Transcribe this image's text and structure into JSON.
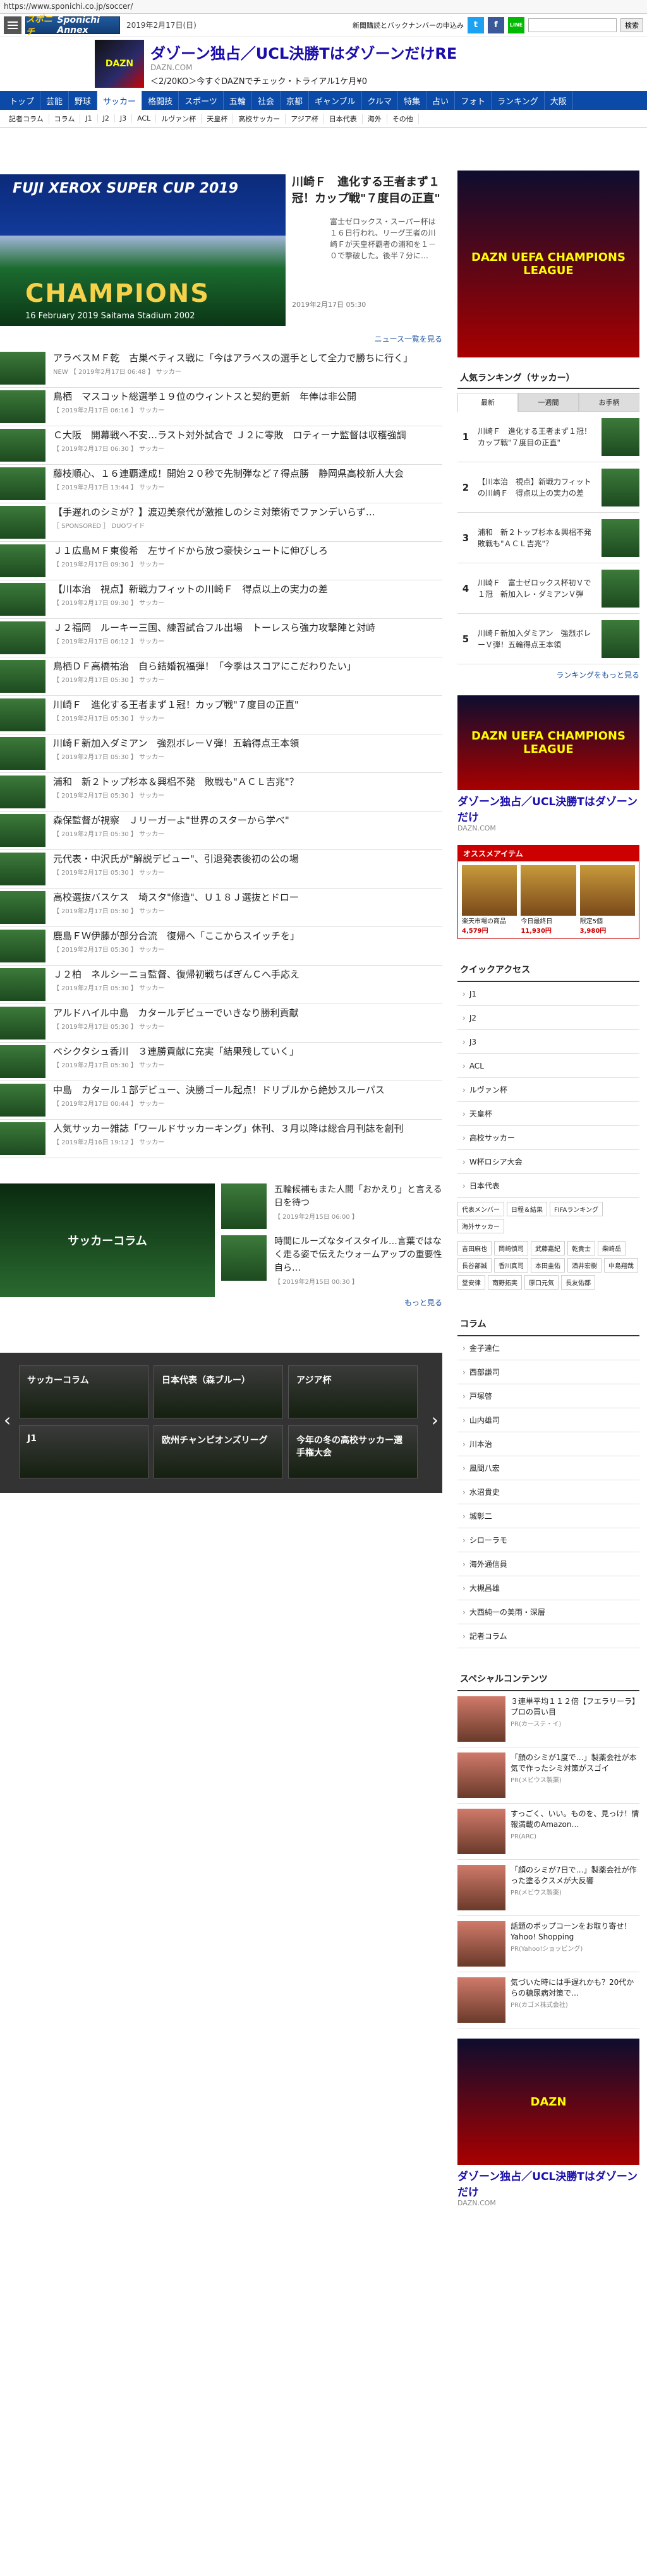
{
  "browser": {
    "url": "https://www.sponichi.co.jp/soccer/"
  },
  "header": {
    "logo": "Sponichi Annex",
    "logo_prefix": "スポニチ",
    "date": "2019年2月17日(日)",
    "sub_link": "新聞購読とバックナンバーの申込み",
    "search_placeholder": "",
    "search_btn": "検索",
    "sns": [
      {
        "name": "twitter",
        "glyph": "t",
        "color": "#1da1f2"
      },
      {
        "name": "facebook",
        "glyph": "f",
        "color": "#3b5998"
      },
      {
        "name": "line",
        "glyph": "LINE",
        "color": "#00b900"
      }
    ]
  },
  "top_ad": {
    "title": "ダゾーン独占／UCL決勝TはダゾーンだけRE",
    "domain": "DAZN.COM",
    "desc": "＜2/20KO＞今すぐDAZNでチェック・トライアル1ケ月¥0",
    "thumb": "DAZN"
  },
  "gnav": [
    "トップ",
    "芸能",
    "野球",
    "サッカー",
    "格闘技",
    "スポーツ",
    "五輪",
    "社会",
    "京都",
    "ギャンブル",
    "クルマ",
    "特集",
    "占い",
    "フォト",
    "ランキング",
    "大阪"
  ],
  "gnav_active": 3,
  "snav": [
    "記者コラム",
    "コラム",
    "J1",
    "J2",
    "J3",
    "ACL",
    "ルヴァン杯",
    "天皇杯",
    "高校サッカー",
    "アジア杯",
    "日本代表",
    "海外",
    "その他"
  ],
  "hero": {
    "banner_top": "FUJI XEROX SUPER CUP 2019",
    "banner_main": "CHAMPIONS",
    "banner_sub": "16 February 2019  Saitama Stadium 2002",
    "title": "川崎Ｆ　進化する王者まず１冠！カップ戦\"７度目の正直\"",
    "summary": "富士ゼロックス・スーパー杯は１６日行われ、リーグ王者の川崎Ｆが天皇杯覇者の浦和を１－０で撃破した。後半７分に…",
    "date": "2019年2月17日 05:30"
  },
  "news_more": "ニュース一覧を見る",
  "news": [
    {
      "title": "アラベスＭＦ乾　古巣ベティス戦に「今はアラベスの選手として全力で勝ちに行く」",
      "meta": "NEW 【 2019年2月17日 06:48 】 サッカー"
    },
    {
      "title": "鳥栖　マスコット総選挙１９位のウィントスと契約更新　年俸は非公開",
      "meta": "【 2019年2月17日 06:16 】 サッカー"
    },
    {
      "title": "Ｃ大阪　開幕戦へ不安…ラスト対外試合で Ｊ２に零敗　ロティーナ監督は収穫強調",
      "meta": "【 2019年2月17日 06:30 】 サッカー"
    },
    {
      "title": "藤枝順心、１６連覇達成！開始２０秒で先制弾など７得点勝　静岡県高校新人大会",
      "meta": "【 2019年2月17日 13:44 】 サッカー"
    },
    {
      "title": "【手遅れのシミが？】渡辺美奈代が激推しのシミ対策術でファンデいらず…",
      "meta": "［ SPONSORED ］ DUOワイド"
    },
    {
      "title": "Ｊ１広島ＭＦ東俊希　左サイドから放つ豪快シュートに伸びしろ",
      "meta": "【 2019年2月17日 09:30 】 サッカー"
    },
    {
      "title": "【川本治　視点】新戦力フィットの川崎Ｆ　得点以上の実力の差",
      "meta": "【 2019年2月17日 09:30 】 サッカー"
    },
    {
      "title": "Ｊ２福岡　ルーキー三国、練習試合フル出場　トーレスら強力攻撃陣と対峙",
      "meta": "【 2019年2月17日 06:12 】 サッカー"
    },
    {
      "title": "鳥栖ＤＦ高橋祐治　自ら結婚祝福弾！「今季はスコアにこだわりたい」",
      "meta": "【 2019年2月17日 05:30 】 サッカー"
    },
    {
      "title": "川崎Ｆ　進化する王者まず１冠！カップ戦\"７度目の正直\"",
      "meta": "【 2019年2月17日 05:30 】 サッカー"
    },
    {
      "title": "川崎Ｆ新加入ダミアン　強烈ボレーＶ弾！五輪得点王本領",
      "meta": "【 2019年2月17日 05:30 】 サッカー"
    },
    {
      "title": "浦和　新２トップ杉本＆興梠不発　敗戦も\"ＡＣＬ吉兆\"？",
      "meta": "【 2019年2月17日 05:30 】 サッカー"
    },
    {
      "title": "森保監督が視察　Ｊリーガーよ\"世界のスターから学べ\"",
      "meta": "【 2019年2月17日 05:30 】 サッカー"
    },
    {
      "title": "元代表・中沢氏が\"解説デビュー\"、引退発表後初の公の場",
      "meta": "【 2019年2月17日 05:30 】 サッカー"
    },
    {
      "title": "高校選抜バスケス　埼スタ\"修造\"、Ｕ１８Ｊ選抜とドロー",
      "meta": "【 2019年2月17日 05:30 】 サッカー"
    },
    {
      "title": "鹿島ＦＷ伊藤が部分合流　復帰へ「ここからスイッチを」",
      "meta": "【 2019年2月17日 05:30 】 サッカー"
    },
    {
      "title": "Ｊ２柏　ネルシーニョ監督、復帰初戦ちばぎんＣへ手応え",
      "meta": "【 2019年2月17日 05:30 】 サッカー"
    },
    {
      "title": "アルドハイル中島　カタールデビューでいきなり勝利貢献",
      "meta": "【 2019年2月17日 05:30 】 サッカー"
    },
    {
      "title": "ベシクタシュ香川　３連勝貢献に充実「結果残していく」",
      "meta": "【 2019年2月17日 05:30 】 サッカー"
    },
    {
      "title": "中島　カタール１部デビュー、決勝ゴール起点！ドリブルから絶妙スルーパス",
      "meta": "【 2019年2月17日 00:44 】 サッカー"
    },
    {
      "title": "人気サッカー雑誌「ワールドサッカーキング」休刊、３月以降は総合月刊誌を創刊",
      "meta": "【 2019年2月16日 19:12 】 サッカー"
    }
  ],
  "column": {
    "banner": "サッカーコラム",
    "items": [
      {
        "title": "五輪候補もまた人間「おかえり」と言える日を待つ",
        "meta": "【 2019年2月15日 06:00 】"
      },
      {
        "title": "時間にルーズなタイスタイル…言葉ではなく走る姿で伝えたウォームアップの重要性　自ら…",
        "meta": "【 2019年2月15日 00:30 】"
      }
    ],
    "more": "もっと見る"
  },
  "carousel": [
    "サッカーコラム",
    "日本代表（森ブルー）",
    "アジア杯",
    "J1",
    "欧州チャンピオンズリーグ",
    "今年の冬の高校サッカー選手権大会"
  ],
  "ranking": {
    "title": "人気ランキング（サッカー）",
    "tabs": [
      "最新",
      "一週間",
      "お手柄"
    ],
    "active_tab": 0,
    "items": [
      {
        "no": "1",
        "title": "川崎Ｆ　進化する王者まず１冠！カップ戦\"７度目の正直\""
      },
      {
        "no": "2",
        "title": "【川本治　視点】新戦力フィットの川崎Ｆ　得点以上の実力の差"
      },
      {
        "no": "3",
        "title": "浦和　新２トップ杉本＆興梠不発　敗戦も\"ＡＣＬ吉兆\"？"
      },
      {
        "no": "4",
        "title": "川崎Ｆ　富士ゼロックス杯初Ｖで１冠　新加入レ・ダミアンＶ弾"
      },
      {
        "no": "5",
        "title": "川崎Ｆ新加入ダミアン　強烈ボレーＶ弾！五輪得点王本領"
      }
    ],
    "more": "ランキングをもっと見る"
  },
  "side_ad": {
    "thumb": "DAZN UEFA CHAMPIONS LEAGUE",
    "title": "ダゾーン独占／UCL決勝Tはダゾーンだけ",
    "domain": "DAZN.COM"
  },
  "osusume": {
    "title": "オススメアイテム",
    "items": [
      {
        "name": "楽天市場の商品",
        "price": "4,579円"
      },
      {
        "name": "今日最終日",
        "price": "11,930円"
      },
      {
        "name": "限定5個",
        "price": "3,980円"
      }
    ]
  },
  "quick": {
    "title": "クイックアクセス",
    "items": [
      "J1",
      "J2",
      "J3",
      "ACL",
      "ルヴァン杯",
      "天皇杯",
      "高校サッカー",
      "W杯ロシア大会",
      "日本代表"
    ],
    "tags": [
      "代表メンバー",
      "日程＆結果",
      "FIFAランキング"
    ],
    "tags2": [
      "海外サッカー"
    ],
    "players": [
      "吉田麻也",
      "岡崎慎司",
      "武藤嘉紀",
      "乾貴士",
      "柴崎岳",
      "長谷部誠",
      "香川真司",
      "本田圭佑",
      "酒井宏樹",
      "中島翔哉",
      "堂安律",
      "南野拓実",
      "原口元気",
      "長友佑都"
    ]
  },
  "column2": {
    "title": "コラム",
    "items": [
      "金子達仁",
      "西部謙司",
      "戸塚啓",
      "山内雄司",
      "川本治",
      "風間八宏",
      "水沼貴史",
      "城彰二",
      "シローラモ",
      "海外通信員",
      "大槻昌雄",
      "大西純一の美雨・深層",
      "記者コラム"
    ]
  },
  "special": {
    "title": "スペシャルコンテンツ",
    "items": [
      {
        "title": "３連単平均１１２倍【フエラリーラ】プロの買い目",
        "pr": "PR(カーステ・イ)"
      },
      {
        "title": "「顔のシミが1度で…」製薬会社が本気で作ったシミ対策がスゴイ",
        "pr": "PR(メビウス製薬)"
      },
      {
        "title": "すっごく、いい。ものを、見っけ！情報満載のAmazon…",
        "pr": "PR(ARC)"
      },
      {
        "title": "「顔のシミが7日で…」製薬会社が作った塗るクスメが大反響",
        "pr": "PR(メビウス製薬)"
      },
      {
        "title": "話題のポップコーンをお取り寄せ！Yahoo! Shopping",
        "pr": "PR(Yahoo!ショッピング)"
      },
      {
        "title": "気づいた時には手遅れかも？20代からの糖尿病対策で…",
        "pr": "PR(カゴメ株式会社)"
      }
    ]
  },
  "side_ad2": {
    "thumb": "DAZN",
    "title": "ダゾーン独占／UCL決勝Tはダゾーンだけ",
    "domain": "DAZN.COM"
  }
}
